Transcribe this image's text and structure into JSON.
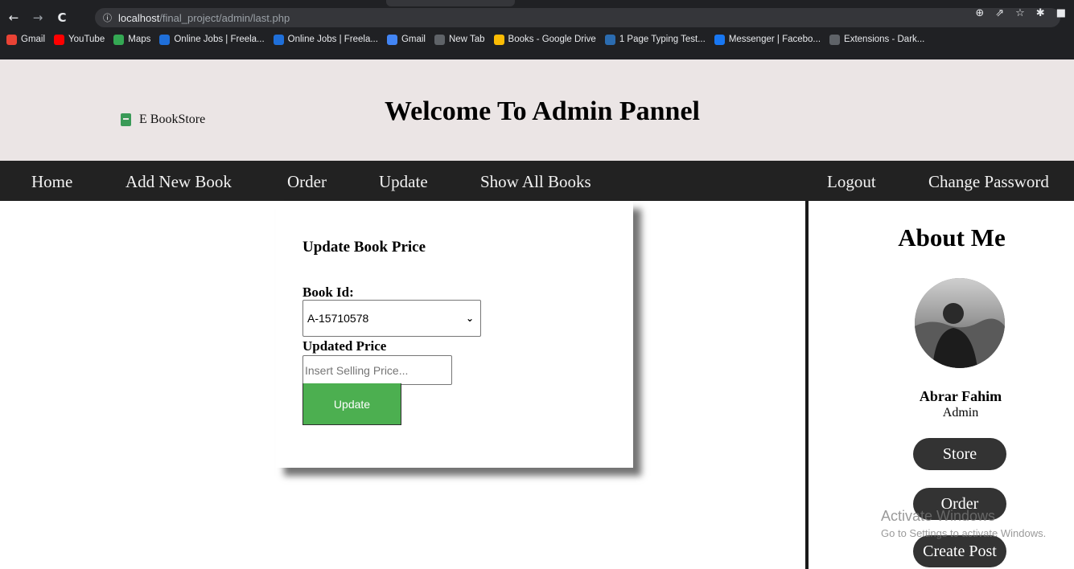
{
  "browser": {
    "url_host": "localhost",
    "url_path": "/final_project/admin/last.php",
    "bookmarks": [
      {
        "label": "Gmail",
        "icon": "gmail-icon",
        "color": "#ea4335"
      },
      {
        "label": "YouTube",
        "icon": "youtube-icon",
        "color": "#ff0000"
      },
      {
        "label": "Maps",
        "icon": "maps-icon",
        "color": "#34a853"
      },
      {
        "label": "Online Jobs | Freela...",
        "icon": "freelancer-icon",
        "color": "#1f6fd9"
      },
      {
        "label": "Online Jobs | Freela...",
        "icon": "freelancer-icon",
        "color": "#1f6fd9"
      },
      {
        "label": "Gmail",
        "icon": "google-icon",
        "color": "#4285f4"
      },
      {
        "label": "New Tab",
        "icon": "chrome-icon",
        "color": "#5f6368"
      },
      {
        "label": "Books - Google Drive",
        "icon": "drive-icon",
        "color": "#fbbc04"
      },
      {
        "label": "1 Page Typing Test...",
        "icon": "typing-icon",
        "color": "#2b6cb0"
      },
      {
        "label": "Messenger | Facebo...",
        "icon": "facebook-icon",
        "color": "#1877f2"
      },
      {
        "label": "Extensions - Dark...",
        "icon": "puzzle-icon",
        "color": "#5f6368"
      }
    ]
  },
  "header": {
    "brand": "E BookStore",
    "title": "Welcome To Admin Pannel"
  },
  "nav": {
    "items": [
      "Home",
      "Add New Book",
      "Order",
      "Update",
      "Show All Books"
    ],
    "right_items": [
      "Logout",
      "Change Password"
    ]
  },
  "form": {
    "title": "Update Book Price",
    "book_id_label": "Book Id:",
    "book_id_value": "A-15710578",
    "price_label": "Updated Price",
    "price_placeholder": "Insert Selling Price...",
    "submit_label": "Update",
    "submit_color": "#4caf50"
  },
  "about": {
    "title": "About Me",
    "name": "Abrar Fahim",
    "role": "Admin",
    "buttons": [
      "Store",
      "Order",
      "Create Post"
    ]
  },
  "watermark": {
    "line1": "Activate Windows",
    "line2": "Go to Settings to activate Windows."
  }
}
